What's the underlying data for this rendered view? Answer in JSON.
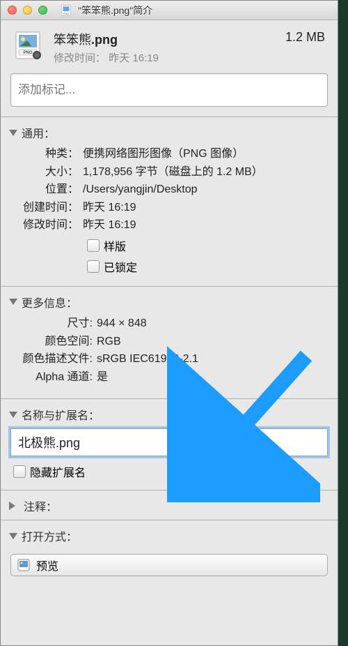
{
  "window": {
    "title": "\"笨笨熊.png\"简介"
  },
  "header": {
    "filename_base": "笨笨熊",
    "filename_ext": ".png",
    "modified_label": "修改时间：",
    "modified_value": "昨天 16:19",
    "size": "1.2 MB"
  },
  "tags": {
    "placeholder": "添加标记..."
  },
  "general": {
    "title": "通用：",
    "kind_label": "种类：",
    "kind_value": "便携网络图形图像（PNG 图像）",
    "size_label": "大小：",
    "size_value": "1,178,956 字节（磁盘上的 1.2 MB）",
    "where_label": "位置：",
    "where_value": "/Users/yangjin/Desktop",
    "created_label": "创建时间：",
    "created_value": "昨天 16:19",
    "modified_label": "修改时间：",
    "modified_value": "昨天 16:19",
    "stationery_label": "样版",
    "locked_label": "已锁定"
  },
  "more_info": {
    "title": "更多信息：",
    "dims_label": "尺寸:",
    "dims_value": "944 × 848",
    "colorspace_label": "颜色空间:",
    "colorspace_value": "RGB",
    "profile_label": "颜色描述文件:",
    "profile_value": "sRGB IEC61966-2.1",
    "alpha_label": "Alpha 通道:",
    "alpha_value": "是"
  },
  "name_ext": {
    "title": "名称与扩展名：",
    "value": "北极熊.png",
    "hide_label": "隐藏扩展名"
  },
  "comments": {
    "title": "注释："
  },
  "open_with": {
    "title": "打开方式：",
    "app": "预览"
  }
}
